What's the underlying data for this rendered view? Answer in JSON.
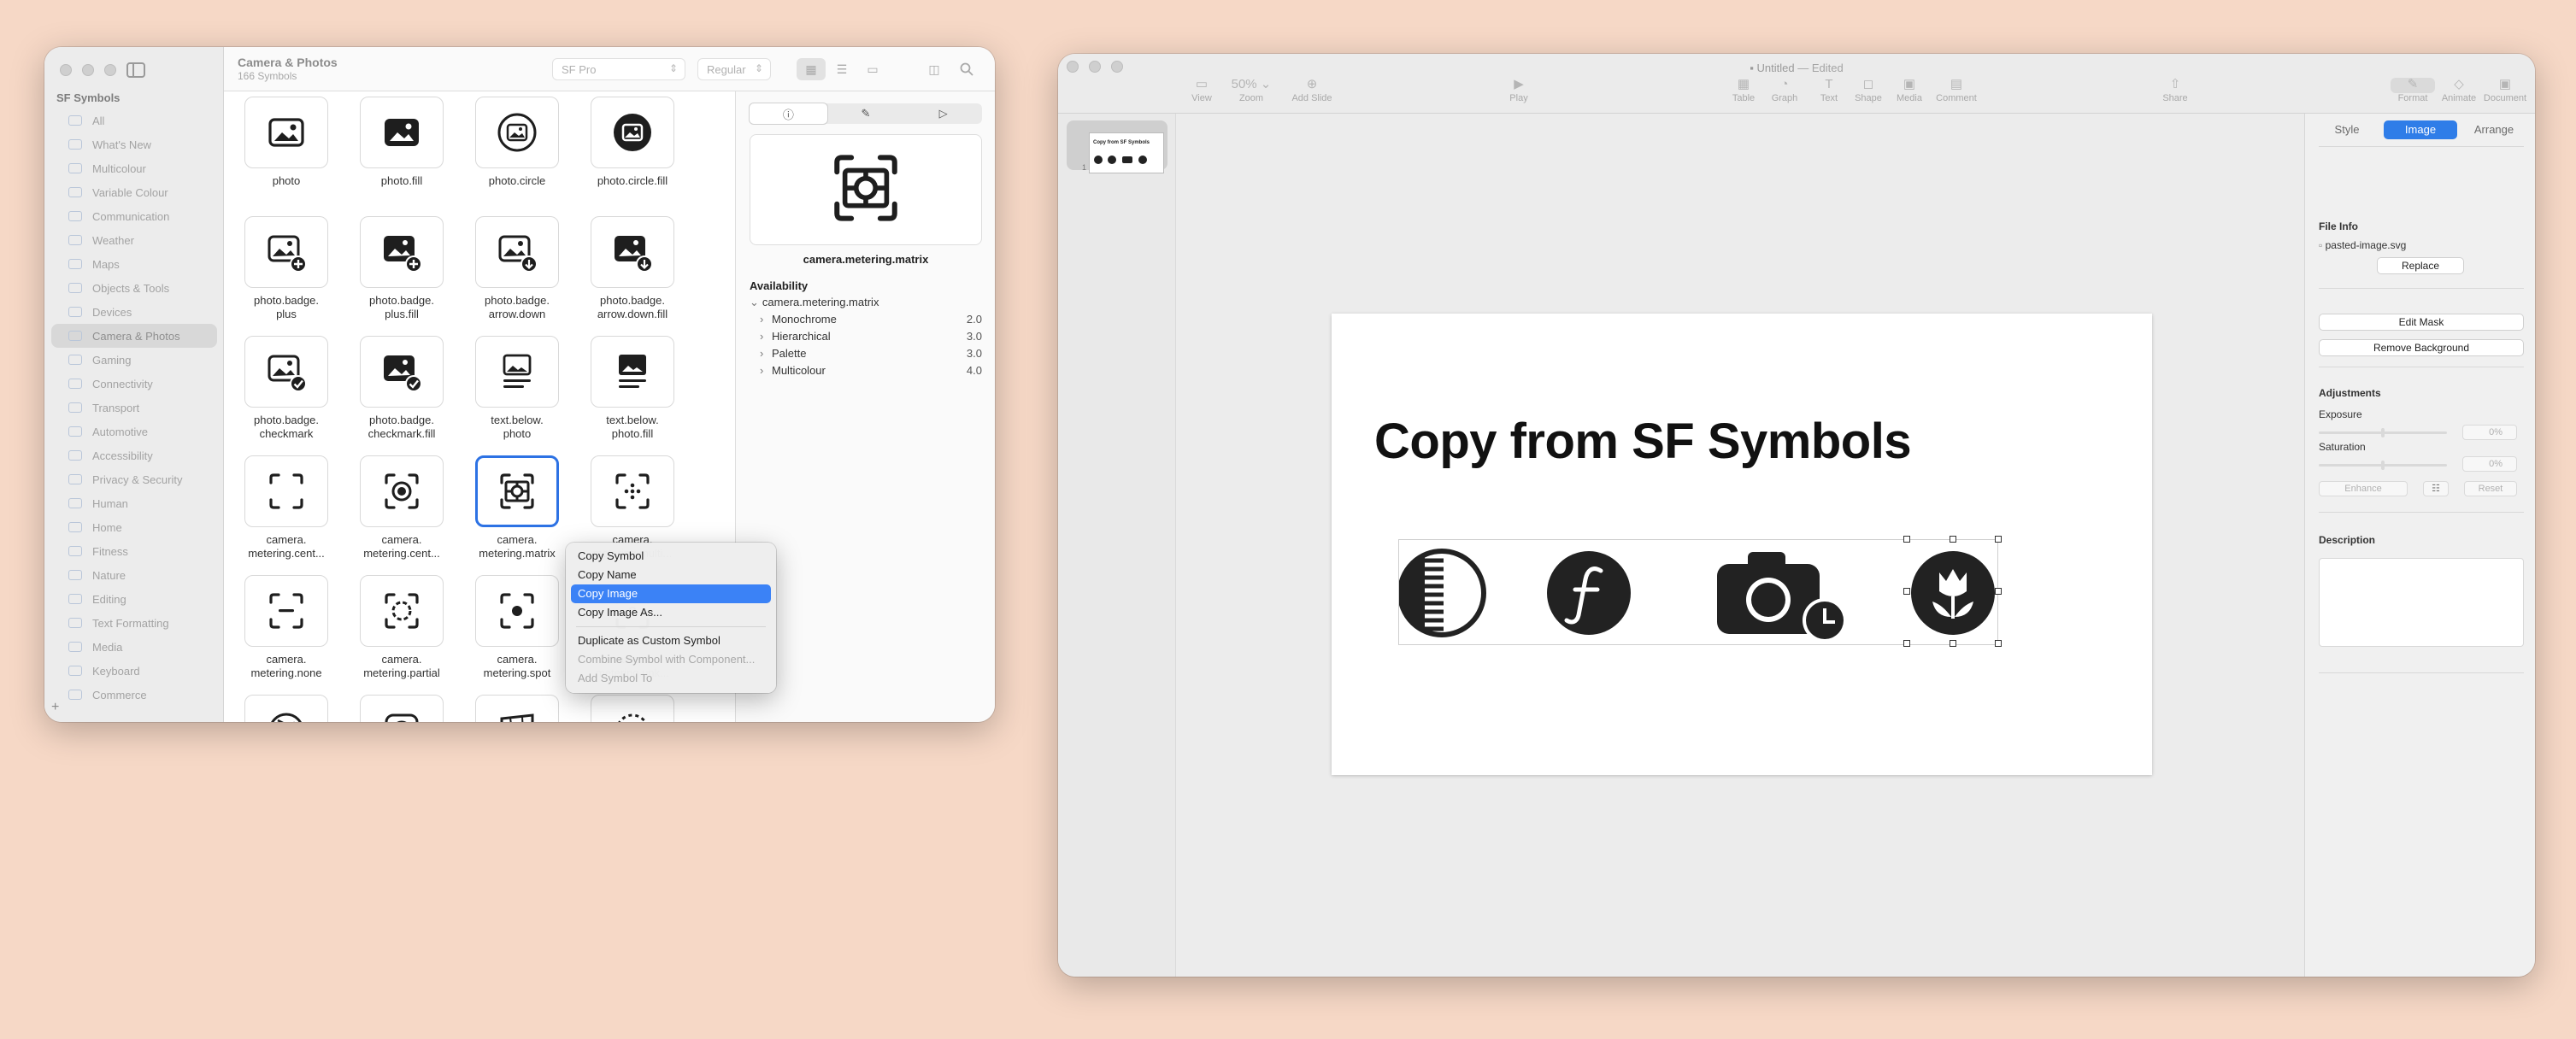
{
  "sf_symbols": {
    "sidebar": {
      "section_title": "SF Symbols",
      "items": [
        "All",
        "What's New",
        "Multicolour",
        "Variable Colour",
        "Communication",
        "Weather",
        "Maps",
        "Objects & Tools",
        "Devices",
        "Camera & Photos",
        "Gaming",
        "Connectivity",
        "Transport",
        "Automotive",
        "Accessibility",
        "Privacy & Security",
        "Human",
        "Home",
        "Fitness",
        "Nature",
        "Editing",
        "Text Formatting",
        "Media",
        "Keyboard",
        "Commerce"
      ],
      "active": "Camera & Photos",
      "add_label": "+"
    },
    "toolbar": {
      "title": "Camera & Photos",
      "subtitle": "166 Symbols",
      "font_select": "SF Pro",
      "weight_select": "Regular"
    },
    "grid": [
      {
        "label": "photo",
        "icon": "photo-icon"
      },
      {
        "label": "photo.fill",
        "icon": "photo-fill-icon"
      },
      {
        "label": "photo.circle",
        "icon": "photo-circle-icon"
      },
      {
        "label": "photo.circle.fill",
        "icon": "photo-circle-fill-icon"
      },
      {
        "label": "photo.badge.\nplus",
        "icon": "photo-badge-plus-icon"
      },
      {
        "label": "photo.badge.\nplus.fill",
        "icon": "photo-badge-plus-fill-icon"
      },
      {
        "label": "photo.badge.\narrow.down",
        "icon": "photo-badge-arrow-down-icon"
      },
      {
        "label": "photo.badge.\narrow.down.fill",
        "icon": "photo-badge-arrow-down-fill-icon"
      },
      {
        "label": "photo.badge.\ncheckmark",
        "icon": "photo-badge-checkmark-icon"
      },
      {
        "label": "photo.badge.\ncheckmark.fill",
        "icon": "photo-badge-checkmark-fill-icon"
      },
      {
        "label": "text.below.\nphoto",
        "icon": "text-below-photo-icon"
      },
      {
        "label": "text.below.\nphoto.fill",
        "icon": "text-below-photo-fill-icon"
      },
      {
        "label": "camera.\nmetering.cent...",
        "icon": "camera-metering-center-weighted-average-icon"
      },
      {
        "label": "camera.\nmetering.cent...",
        "icon": "camera-metering-center-weighted-icon"
      },
      {
        "label": "camera.\nmetering.matrix",
        "icon": "camera-metering-matrix-icon"
      },
      {
        "label": "camera.\nmetering.multi...",
        "icon": "camera-metering-multispot-icon"
      },
      {
        "label": "camera.\nmetering.none",
        "icon": "camera-metering-none-icon"
      },
      {
        "label": "camera.\nmetering.partial",
        "icon": "camera-metering-partial-icon"
      },
      {
        "label": "camera.\nmetering.spot",
        "icon": "camera-metering-spot-icon"
      },
      {
        "label": "camera.\nmetering.unk...",
        "icon": "camera-metering-unknown-icon"
      },
      {
        "label": "",
        "icon": "camera-aperture-icon"
      },
      {
        "label": "",
        "icon": "circle-slash-icon"
      },
      {
        "label": "",
        "icon": "perspective-icon"
      },
      {
        "label": "",
        "icon": "dotted-circle-icon"
      }
    ],
    "selected_index": 14,
    "inspector": {
      "tabs": [
        "info-icon",
        "brush-icon",
        "play-icon"
      ],
      "symbol_name": "camera.metering.matrix",
      "availability_title": "Availability",
      "availability_root": "camera.metering.matrix",
      "modes": [
        {
          "label": "Monochrome",
          "version": "2.0"
        },
        {
          "label": "Hierarchical",
          "version": "3.0"
        },
        {
          "label": "Palette",
          "version": "3.0"
        },
        {
          "label": "Multicolour",
          "version": "4.0"
        }
      ]
    },
    "context_menu": {
      "items": [
        {
          "label": "Copy Symbol",
          "state": "normal"
        },
        {
          "label": "Copy Name",
          "state": "normal"
        },
        {
          "label": "Copy Image",
          "state": "highlighted"
        },
        {
          "label": "Copy Image As...",
          "state": "normal"
        },
        {
          "label": "Duplicate as Custom Symbol",
          "state": "normal"
        },
        {
          "label": "Combine Symbol with Component...",
          "state": "disabled"
        },
        {
          "label": "Add Symbol To",
          "state": "disabled"
        }
      ]
    }
  },
  "keynote": {
    "title": "Untitled",
    "title_suffix": "— Edited",
    "toolbar": {
      "left": [
        {
          "label": "View",
          "glyph": "▭"
        },
        {
          "label": "Zoom",
          "glyph": "50% ⌄"
        },
        {
          "label": "Add Slide",
          "glyph": "⊕"
        }
      ],
      "play": {
        "label": "Play",
        "glyph": "▶"
      },
      "insert": [
        {
          "label": "Table",
          "glyph": "▦"
        },
        {
          "label": "Graph",
          "glyph": "◔"
        },
        {
          "label": "Text",
          "glyph": "T"
        },
        {
          "label": "Shape",
          "glyph": "◻"
        },
        {
          "label": "Media",
          "glyph": "▣"
        },
        {
          "label": "Comment",
          "glyph": "▤"
        }
      ],
      "share": {
        "label": "Share",
        "glyph": "⇧"
      },
      "right": [
        {
          "label": "Format",
          "glyph": "✎"
        },
        {
          "label": "Animate",
          "glyph": "◇"
        },
        {
          "label": "Document",
          "glyph": "▣"
        }
      ]
    },
    "navigator": {
      "slide_number": "1",
      "thumb_title": "Copy from SF Symbols"
    },
    "slide": {
      "title": "Copy from SF Symbols"
    },
    "inspector": {
      "tabs": [
        "Style",
        "Image",
        "Arrange"
      ],
      "active_tab": "Image",
      "file_info_title": "File Info",
      "file_name": "pasted-image.svg",
      "replace": "Replace",
      "edit_mask": "Edit Mask",
      "remove_background": "Remove Background",
      "adjustments_title": "Adjustments",
      "exposure_label": "Exposure",
      "exposure_value": "0%",
      "saturation_label": "Saturation",
      "saturation_value": "0%",
      "enhance": "Enhance",
      "reset": "Reset",
      "description_title": "Description"
    }
  },
  "colors": {
    "desktop": "#f6d8c6",
    "accent": "#2f7de8",
    "selection": "#2d72e4"
  }
}
